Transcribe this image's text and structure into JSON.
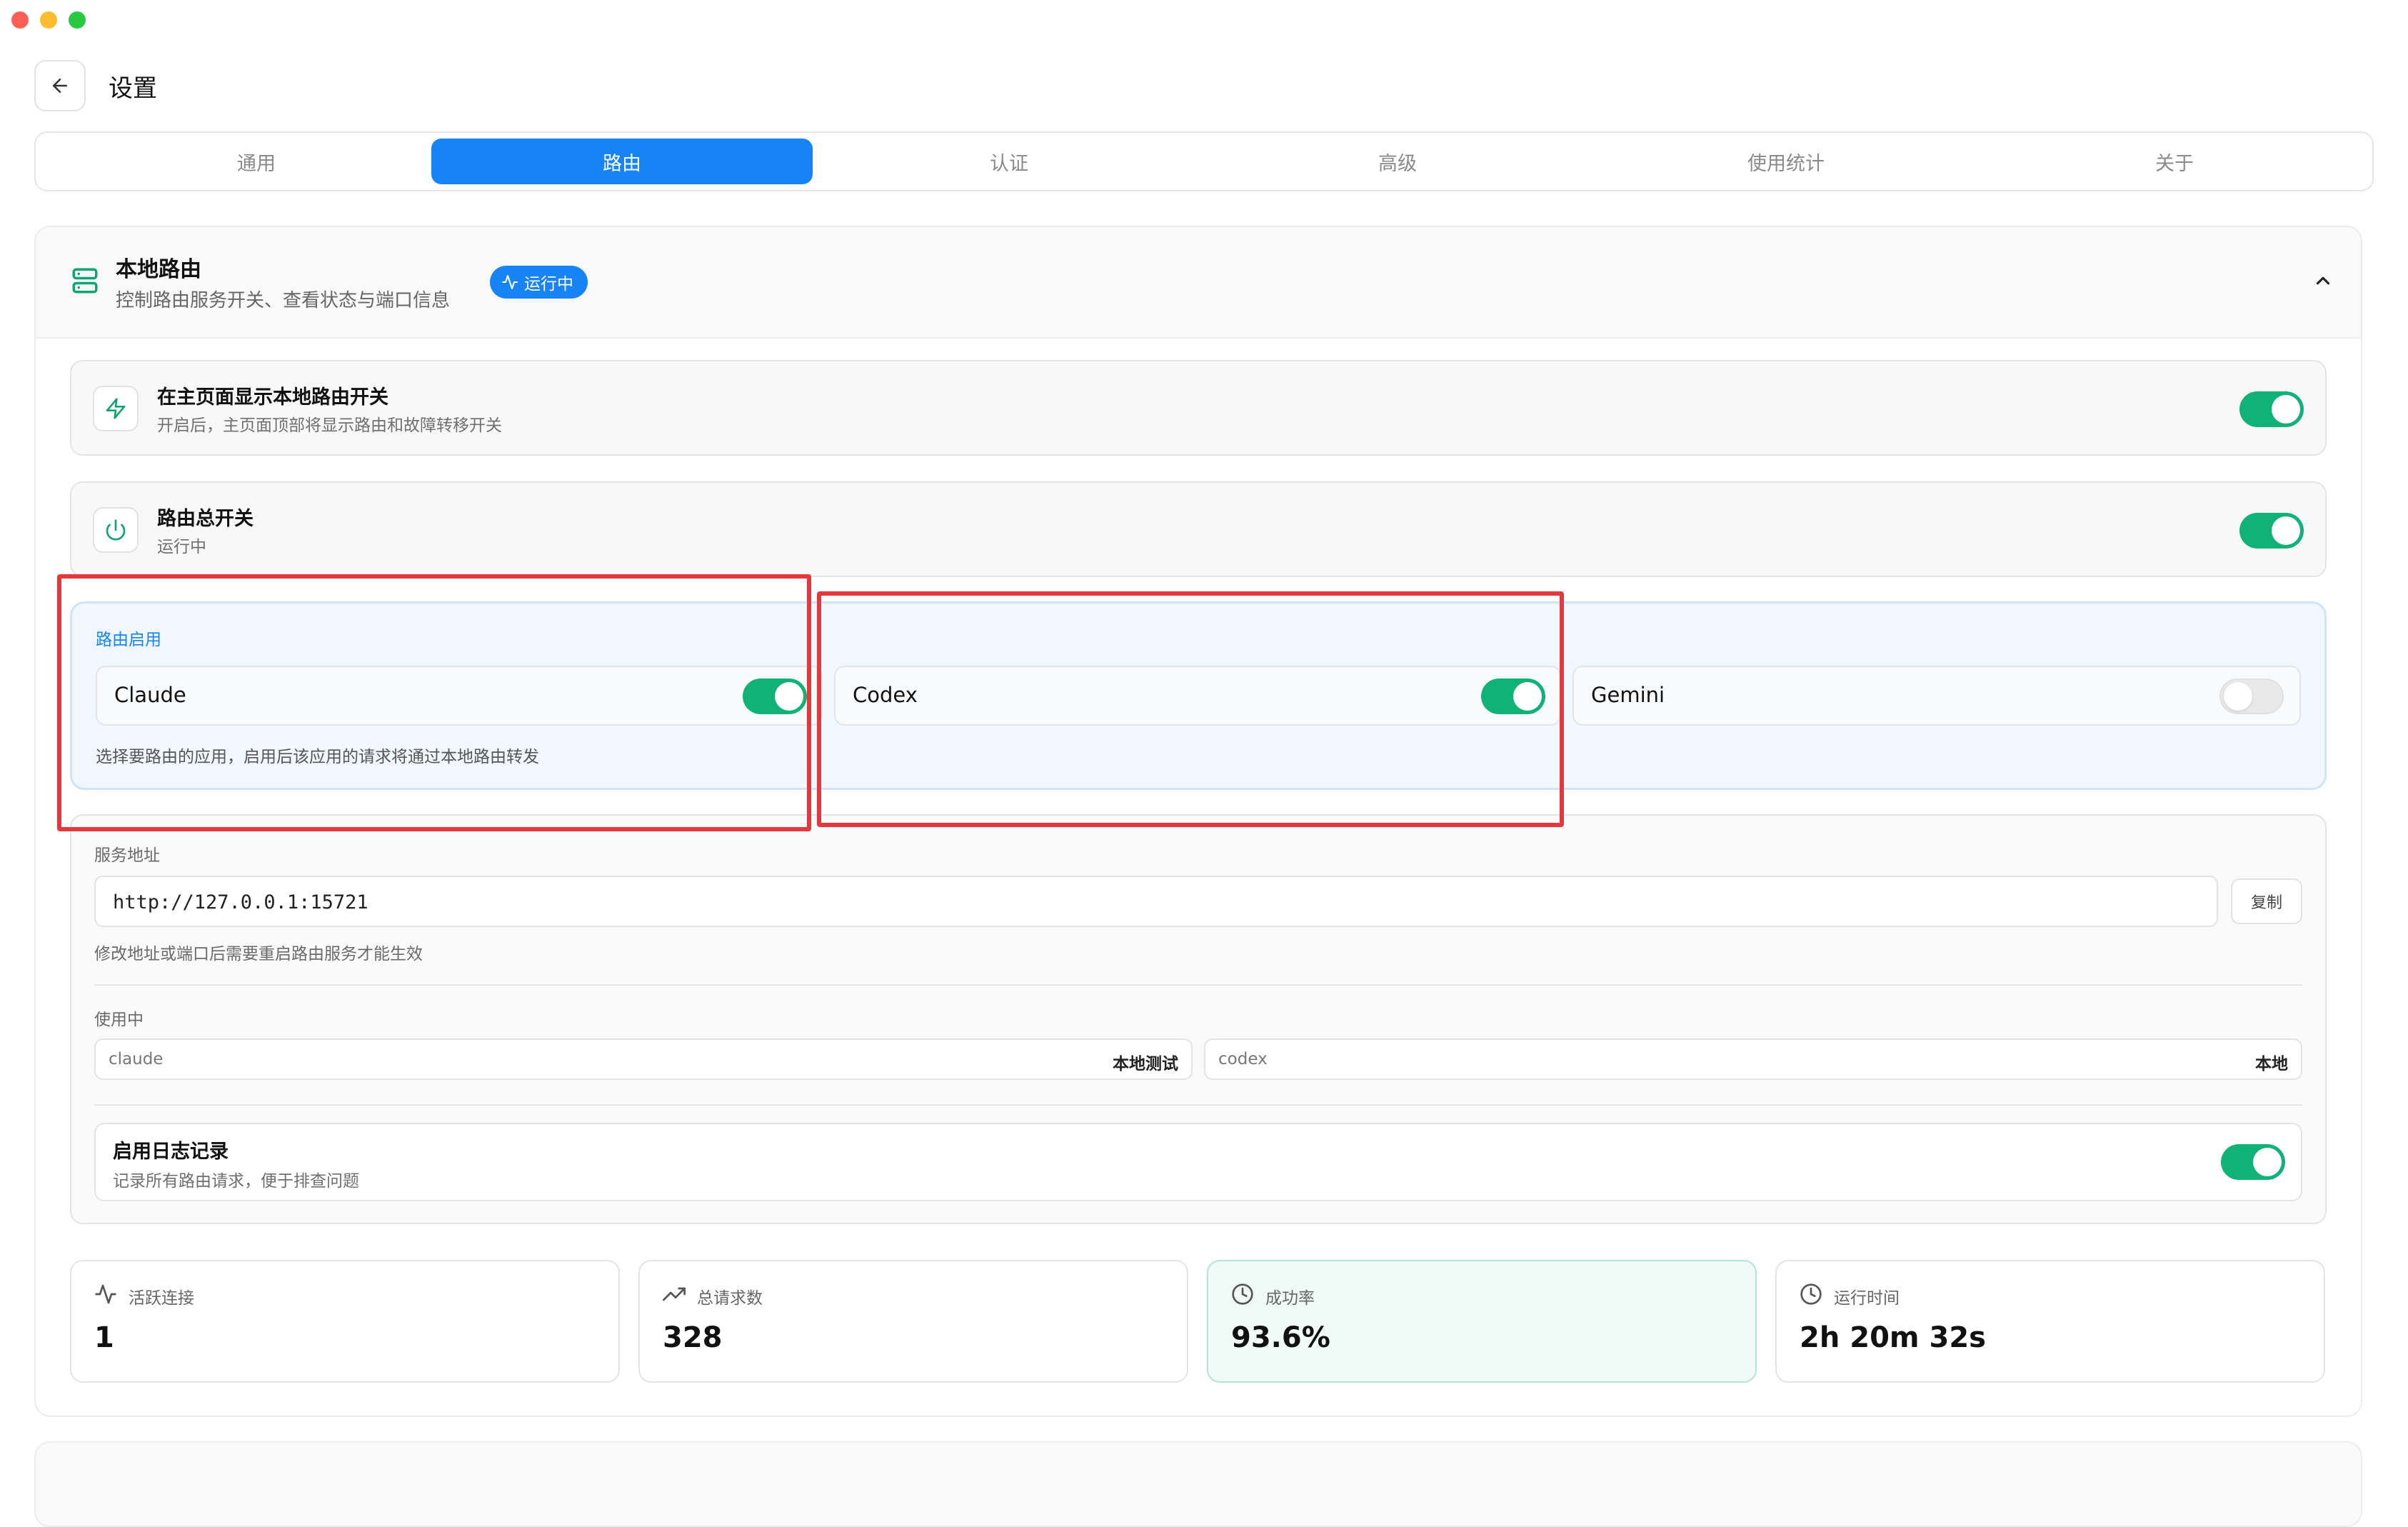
{
  "window": {
    "traffic_lights": {
      "close": "#ff5f57",
      "minimize": "#febc2e",
      "zoom": "#28c840"
    }
  },
  "header": {
    "title": "设置"
  },
  "tabs": [
    {
      "label": "通用",
      "active": false
    },
    {
      "label": "路由",
      "active": true
    },
    {
      "label": "认证",
      "active": false
    },
    {
      "label": "高级",
      "active": false
    },
    {
      "label": "使用统计",
      "active": false
    },
    {
      "label": "关于",
      "active": false
    }
  ],
  "section": {
    "title": "本地路由",
    "subtitle": "控制路由服务开关、查看状态与端口信息",
    "status_badge": "运行中",
    "collapsed": false
  },
  "settings": {
    "show_on_home": {
      "title": "在主页面显示本地路由开关",
      "description": "开启后，主页面顶部将显示路由和故障转移开关",
      "enabled": true
    },
    "master_switch": {
      "title": "路由总开关",
      "description": "运行中",
      "enabled": true
    }
  },
  "routing_apps": {
    "label": "路由启用",
    "apps": [
      {
        "name": "Claude",
        "enabled": true
      },
      {
        "name": "Codex",
        "enabled": true
      },
      {
        "name": "Gemini",
        "enabled": false
      }
    ],
    "hint": "选择要路由的应用，启用后该应用的请求将通过本地路由转发"
  },
  "service": {
    "address_label": "服务地址",
    "address_value": "http://127.0.0.1:15721",
    "copy_label": "复制",
    "address_hint": "修改地址或端口后需要重启路由服务才能生效",
    "in_use_label": "使用中",
    "in_use": [
      {
        "app": "claude",
        "provider": "本地测试"
      },
      {
        "app": "codex",
        "provider": "本地"
      }
    ]
  },
  "logging": {
    "title": "启用日志记录",
    "description": "记录所有路由请求，便于排查问题",
    "enabled": true
  },
  "stats": [
    {
      "label": "活跃连接",
      "value": "1",
      "icon": "activity-icon"
    },
    {
      "label": "总请求数",
      "value": "328",
      "icon": "trending-up-icon"
    },
    {
      "label": "成功率",
      "value": "93.6%",
      "icon": "clock-icon"
    },
    {
      "label": "运行时间",
      "value": "2h 20m 32s",
      "icon": "clock-icon"
    }
  ],
  "colors": {
    "accent": "#1683f7",
    "toggle_on": "#10b277",
    "success_icon": "#10a56e",
    "highlight_box": "#e5383d"
  }
}
